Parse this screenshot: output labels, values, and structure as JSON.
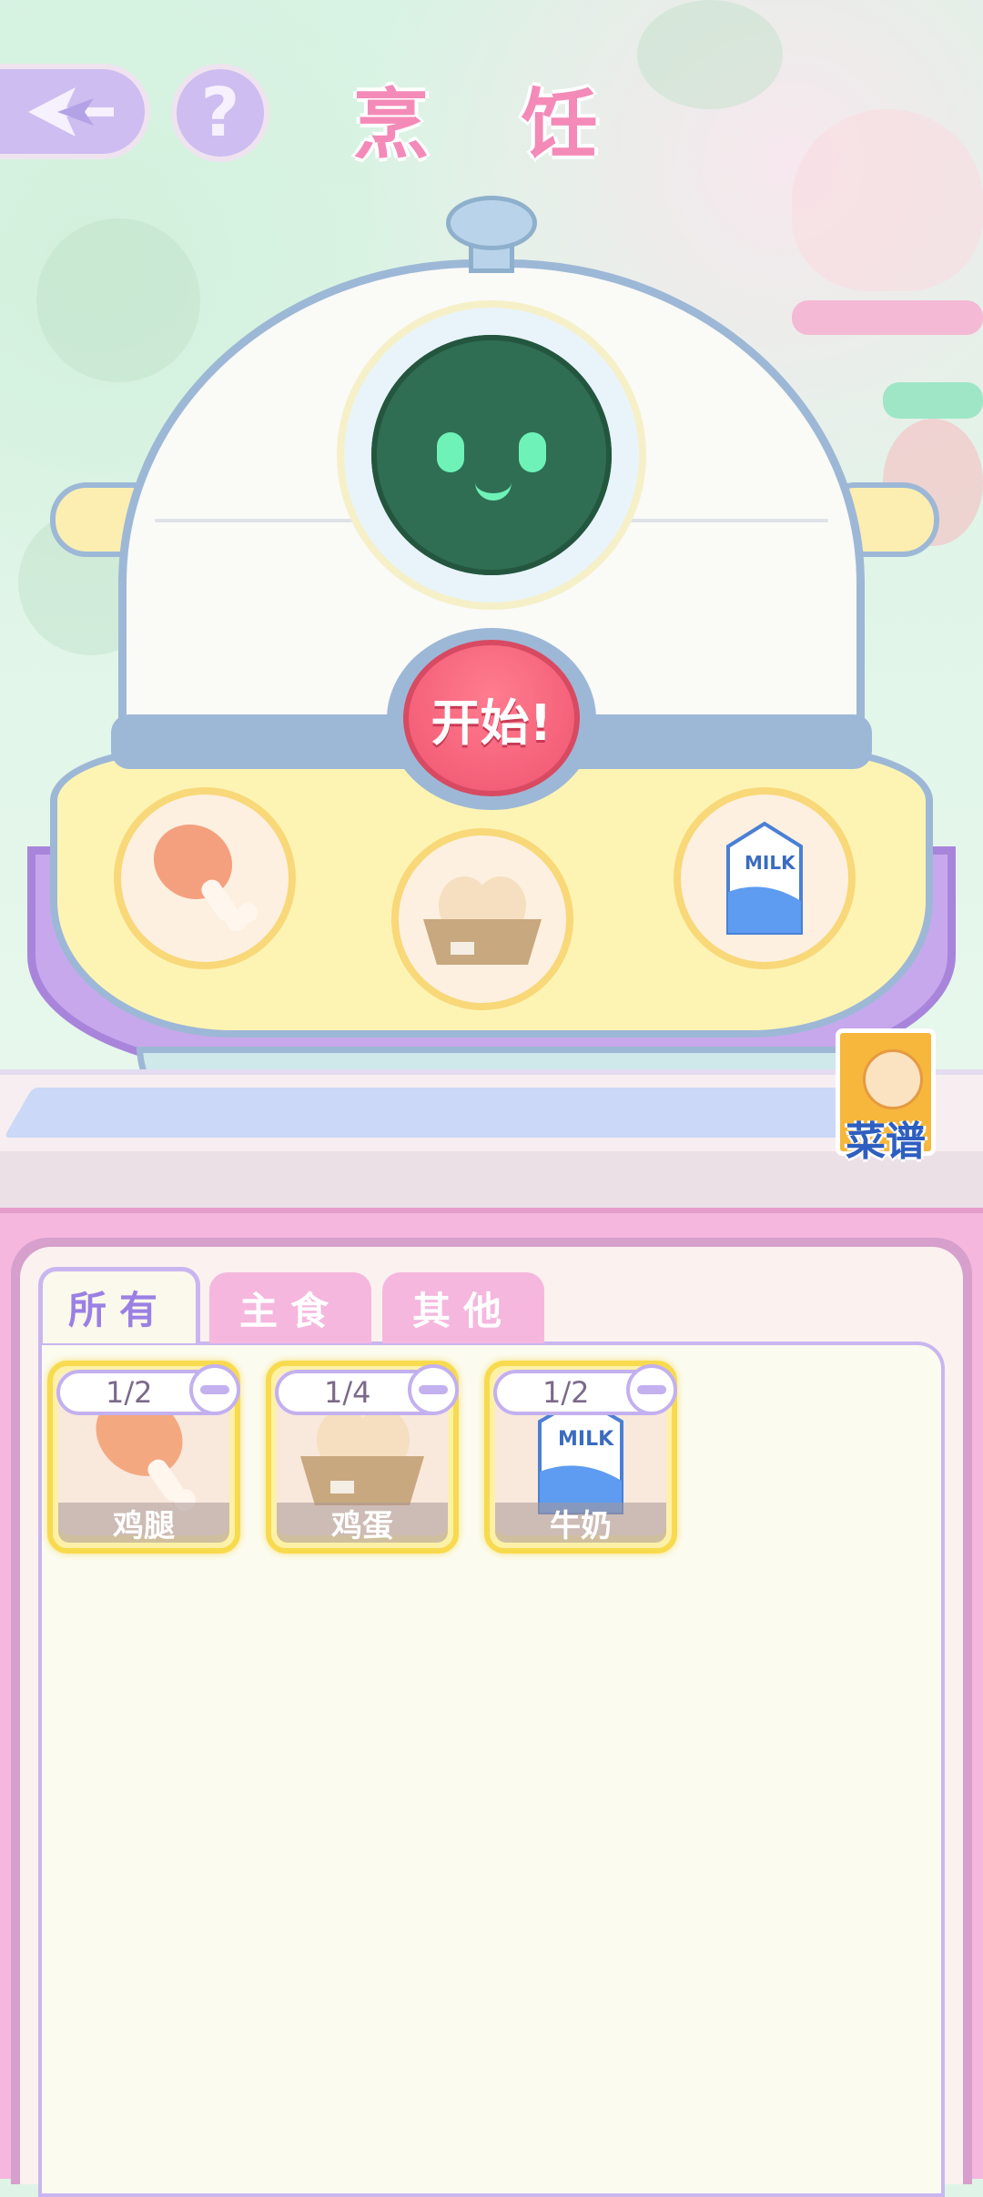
{
  "header": {
    "title": "烹 饪",
    "help_label": "?"
  },
  "cooker": {
    "start_label": "开始!",
    "slots": [
      "drumstick",
      "eggs",
      "milk"
    ]
  },
  "recipe": {
    "label": "菜谱"
  },
  "tabs": [
    {
      "label": "所有",
      "active": true
    },
    {
      "label": "主食",
      "active": false
    },
    {
      "label": "其他",
      "active": false
    }
  ],
  "items": [
    {
      "name": "鸡腿",
      "count": "1/2",
      "icon": "drumstick-icon"
    },
    {
      "name": "鸡蛋",
      "count": "1/4",
      "icon": "eggs-icon"
    },
    {
      "name": "牛奶",
      "count": "1/2",
      "icon": "milk-icon"
    }
  ],
  "colors": {
    "title": "#f48ab8",
    "start": "#ef5570",
    "tab_active": "#9b80e4",
    "panel": "#f5b7de"
  }
}
